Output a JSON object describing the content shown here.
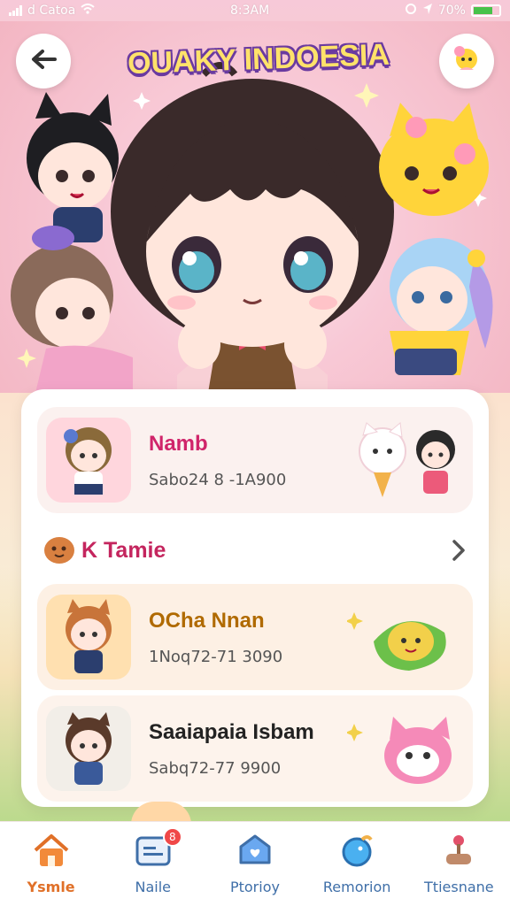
{
  "status_bar": {
    "carrier": "d Catoa",
    "time": "8:3AM",
    "battery": "70%"
  },
  "hero": {
    "title": "OUAKY INDOESIA"
  },
  "rows": [
    {
      "title": "Namb",
      "subtitle": "Sabo24 8 -1A900",
      "bg": "#fbf1ef",
      "title_color": "#d0246a"
    },
    {
      "title": "OCha Nnan",
      "subtitle": "1Noq72-71 3090",
      "bg": "#fdf0e4",
      "title_color": "#b06a00"
    },
    {
      "title": "Saaiapaia Isbam",
      "subtitle": "Sabq72-77 9900",
      "bg": "#fdf3ec",
      "title_color": "#222222"
    }
  ],
  "section": {
    "title": "K Tamie"
  },
  "nav": [
    {
      "label": "Ysmle",
      "icon": "home-icon"
    },
    {
      "label": "Naile",
      "icon": "mail-icon",
      "badge": "8"
    },
    {
      "label": "Ptorioy",
      "icon": "favorite-icon"
    },
    {
      "label": "Remorion",
      "icon": "bird-icon"
    },
    {
      "label": "Ttiesnane",
      "icon": "joystick-icon"
    }
  ],
  "colors": {
    "accent": "#e07028",
    "title_fill": "#ffe26a",
    "title_outline": "#6a3aa0"
  }
}
